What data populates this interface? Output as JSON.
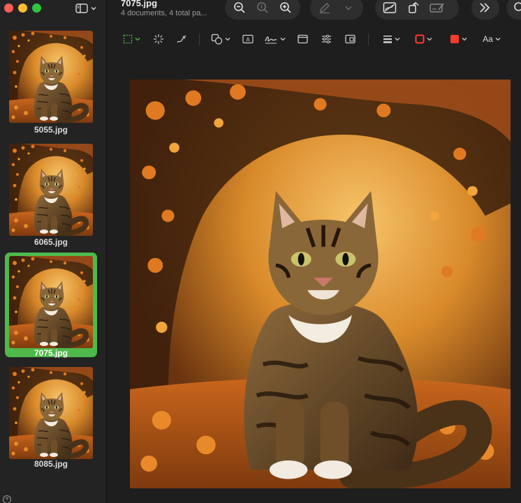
{
  "window": {
    "title": "7075.jpg",
    "subtitle": "4 documents, 4 total pa..."
  },
  "sidebar": {
    "items": [
      {
        "label": "5055.jpg",
        "selected": false
      },
      {
        "label": "6065.jpg",
        "selected": false
      },
      {
        "label": "7075.jpg",
        "selected": true
      },
      {
        "label": "8085.jpg",
        "selected": false
      }
    ]
  },
  "toolbar": {
    "zoom_out_icon": "zoom-out-icon",
    "actual_size_icon": "zoom-actual-icon",
    "zoom_in_icon": "zoom-in-icon",
    "highlight_icon": "pencil-icon",
    "markup_icon": "markup-icon",
    "rotate_icon": "rotate-icon",
    "redact_icon": "redact-icon",
    "more_icon": "chevron-double-right-icon",
    "search_icon": "search-icon",
    "text_style_label": "Aa"
  },
  "colors": {
    "accent_selected": "#4fb94a",
    "border_color": "#ff3b30",
    "fill_color": "#ff3b30"
  },
  "photo": {
    "subject": "tabby-cat-autumn-forest"
  }
}
